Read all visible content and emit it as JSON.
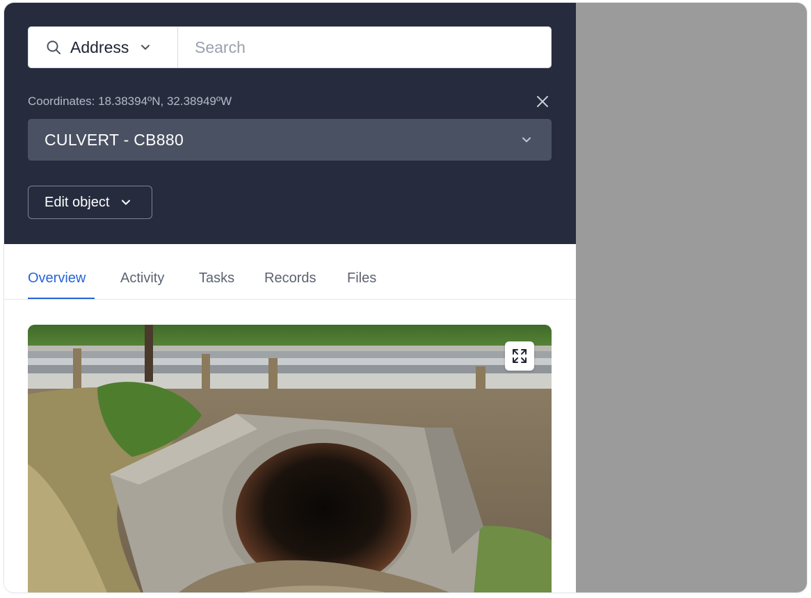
{
  "search": {
    "type_label": "Address",
    "placeholder": "Search",
    "value": ""
  },
  "coordinates_text": "Coordinates: 18.38394ºN, 32.38949ºW",
  "object_select": {
    "value": "CULVERT - CB880"
  },
  "edit_button_label": "Edit object",
  "tabs": [
    {
      "label": "Overview",
      "active": true
    },
    {
      "label": "Activity",
      "active": false
    },
    {
      "label": "Tasks",
      "active": false
    },
    {
      "label": "Records",
      "active": false
    },
    {
      "label": "Files",
      "active": false
    }
  ],
  "photo": {
    "subject": "culvert-photo",
    "expand_icon": "expand-icon"
  },
  "icons": {
    "search": "search-icon",
    "close": "close-icon",
    "chevron": "chevron-down-icon"
  },
  "colors": {
    "header_bg": "#262c3e",
    "select_bg": "#4a5162",
    "accent": "#2563d9",
    "map_bg": "#9b9b9b"
  }
}
